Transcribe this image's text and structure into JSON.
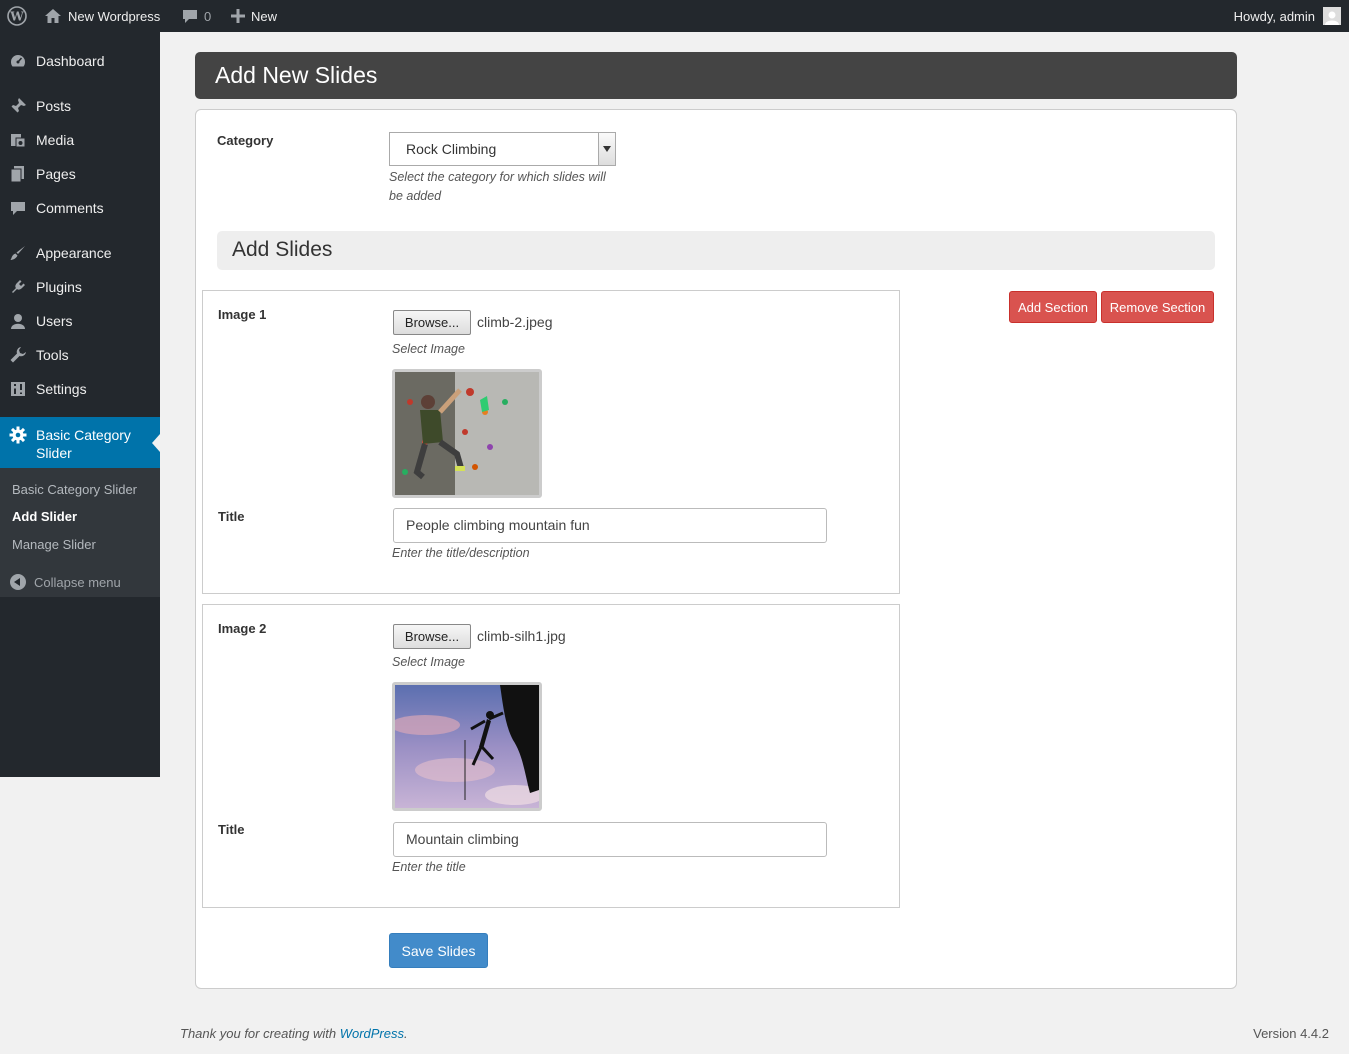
{
  "adminbar": {
    "site_name": "New Wordpress",
    "comments_count": "0",
    "new_label": "New",
    "howdy": "Howdy, admin"
  },
  "sidebar": {
    "items": [
      {
        "label": "Dashboard",
        "icon": "dashboard-icon"
      },
      {
        "label": "Posts",
        "icon": "pin-icon"
      },
      {
        "label": "Media",
        "icon": "media-icon"
      },
      {
        "label": "Pages",
        "icon": "pages-icon"
      },
      {
        "label": "Comments",
        "icon": "comment-icon"
      },
      {
        "label": "Appearance",
        "icon": "brush-icon"
      },
      {
        "label": "Plugins",
        "icon": "plug-icon"
      },
      {
        "label": "Users",
        "icon": "user-icon"
      },
      {
        "label": "Tools",
        "icon": "wrench-icon"
      },
      {
        "label": "Settings",
        "icon": "settings-icon"
      },
      {
        "label": "Basic Category Slider",
        "icon": "gear-icon"
      }
    ],
    "submenu": [
      "Basic Category Slider",
      "Add Slider",
      "Manage Slider"
    ],
    "collapse": "Collapse menu"
  },
  "page": {
    "title": "Add New Slides",
    "category_label": "Category",
    "category_value": "Rock Climbing",
    "category_desc": "Select the category for which slides will be added",
    "add_slides_heading": "Add Slides",
    "add_section": "Add Section",
    "remove_section": "Remove Section",
    "save": "Save Slides"
  },
  "slides": [
    {
      "image_label": "Image 1",
      "browse": "Browse...",
      "filename": "climb-2.jpeg",
      "select_desc": "Select Image",
      "title_label": "Title",
      "title_value": "People climbing mountain fun",
      "title_desc": "Enter the title/description"
    },
    {
      "image_label": "Image 2",
      "browse": "Browse...",
      "filename": "climb-silh1.jpg",
      "select_desc": "Select Image",
      "title_label": "Title",
      "title_value": "Mountain climbing",
      "title_desc": "Enter the title"
    }
  ],
  "footer": {
    "thanks": "Thank you for creating with",
    "link": "WordPress",
    "version": "Version 4.4.2"
  }
}
